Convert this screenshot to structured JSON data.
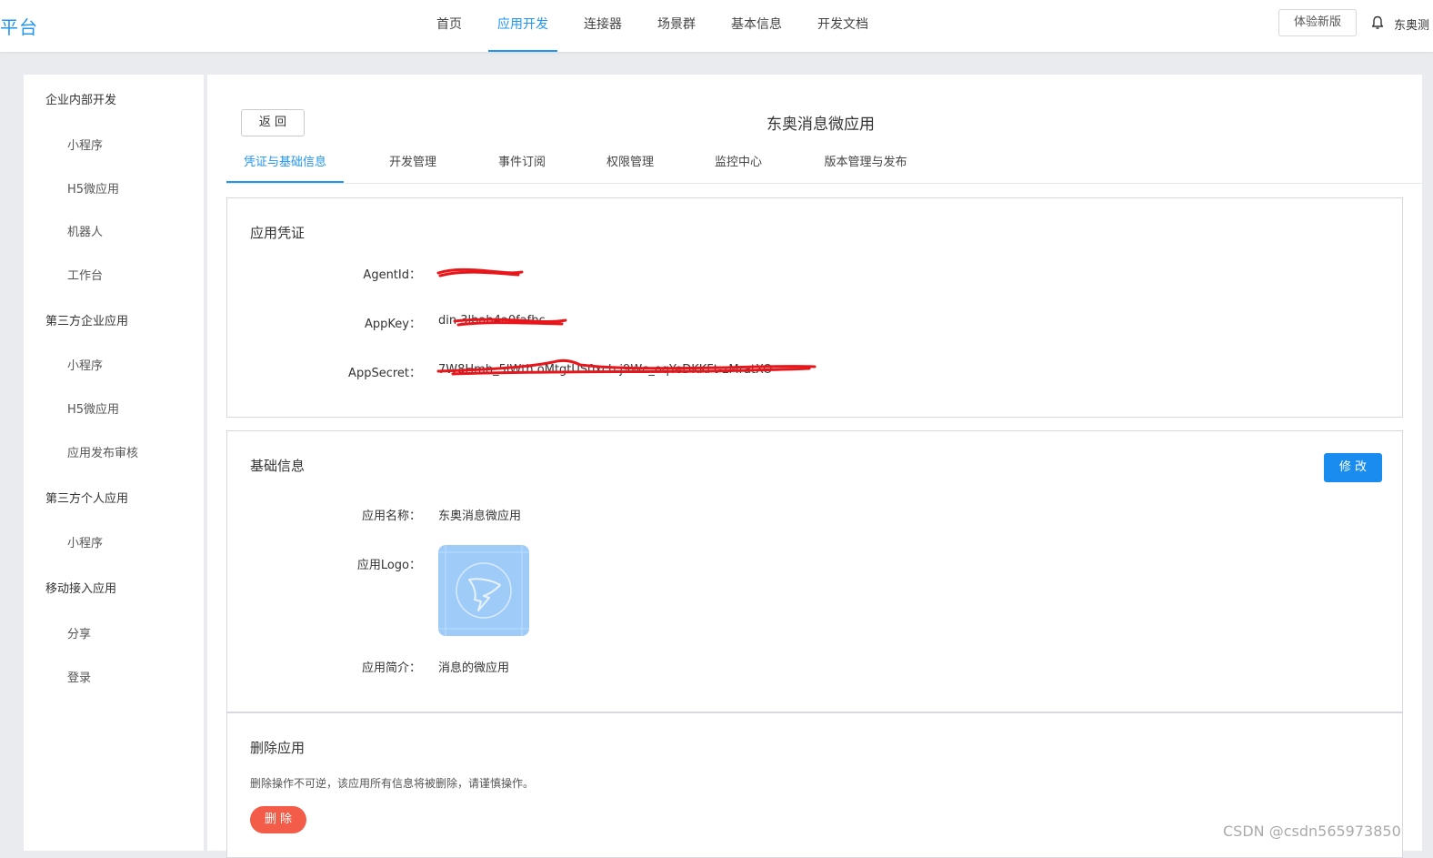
{
  "header": {
    "brand": "平台",
    "nav": [
      {
        "label": "首页",
        "active": false
      },
      {
        "label": "应用开发",
        "active": true
      },
      {
        "label": "连接器",
        "active": false
      },
      {
        "label": "场景群",
        "active": false
      },
      {
        "label": "基本信息",
        "active": false
      },
      {
        "label": "开发文档",
        "active": false
      }
    ],
    "try_new_label": "体验新版",
    "bell_icon": "bell-icon",
    "user_name": "东奥测"
  },
  "sidebar": {
    "groups": [
      {
        "label": "企业内部开发",
        "items": [
          "小程序",
          "H5微应用",
          "机器人",
          "工作台"
        ]
      },
      {
        "label": "第三方企业应用",
        "items": [
          "小程序",
          "H5微应用",
          "应用发布审核"
        ]
      },
      {
        "label": "第三方个人应用",
        "items": [
          "小程序"
        ]
      },
      {
        "label": "移动接入应用",
        "items": [
          "分享",
          "登录"
        ]
      }
    ]
  },
  "main": {
    "back_label": "返 回",
    "title": "东奥消息微应用",
    "tabs": [
      {
        "label": "凭证与基础信息",
        "active": true
      },
      {
        "label": "开发管理",
        "active": false
      },
      {
        "label": "事件订阅",
        "active": false
      },
      {
        "label": "权限管理",
        "active": false
      },
      {
        "label": "监控中心",
        "active": false
      },
      {
        "label": "版本管理与发布",
        "active": false
      }
    ],
    "credentials": {
      "title": "应用凭证",
      "agentid_label": "AgentId：",
      "agentid_value": "",
      "appkey_label": "AppKey：",
      "appkey_value": "din         3lbab4a0fafbc",
      "appsecret_label": "AppSecret：",
      "appsecret_value": "7W8Hmh_5lWth             oMtgtUS0xcb             j9Wc_oqYeDKKFt-zMratXO"
    },
    "basic_info": {
      "title": "基础信息",
      "edit_label": "修 改",
      "name_label": "应用名称：",
      "name_value": "东奥消息微应用",
      "logo_label": "应用Logo：",
      "logo_icon": "dingtalk-logo-icon",
      "desc_label": "应用简介：",
      "desc_value": "消息的微应用"
    },
    "delete": {
      "title": "删除应用",
      "warning": "删除操作不可逆，该应用所有信息将被删除，请谨慎操作。",
      "delete_label": "删 除"
    }
  },
  "watermark": "CSDN @csdn565973850",
  "colors": {
    "accent": "#2196f3",
    "primary_button": "#1a8cf0",
    "danger_button": "#f25c48",
    "redaction": "#e8161b",
    "page_bg": "#e9ebef"
  }
}
